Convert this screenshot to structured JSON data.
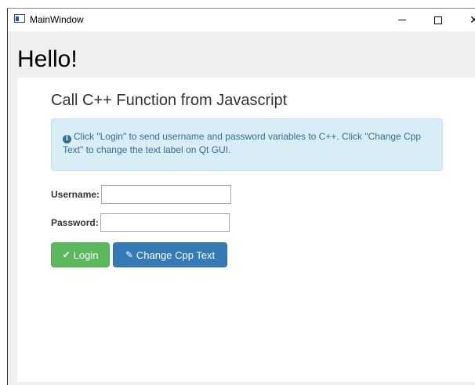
{
  "window": {
    "title": "MainWindow",
    "controls": {
      "minimize": "–",
      "maximize": "☐",
      "close": "✕"
    }
  },
  "qt_label": {
    "text": "Hello!"
  },
  "page": {
    "heading": "Call C++ Function from Javascript",
    "alert": {
      "icon": "info-circle-icon",
      "text": "Click \"Login\" to send username and password variables to C++. Click \"Change Cpp Text\" to change the text label on Qt GUI."
    },
    "form": {
      "username_label": "Username:",
      "username_value": "",
      "password_label": "Password:",
      "password_value": ""
    },
    "buttons": {
      "login_label": "Login",
      "login_icon": "check-icon",
      "change_label": "Change Cpp Text",
      "change_icon": "pencil-icon"
    }
  },
  "colors": {
    "login_button": "#5cb85c",
    "change_button": "#337ab7",
    "alert_background": "#d9edf7",
    "alert_text": "#31708f"
  }
}
